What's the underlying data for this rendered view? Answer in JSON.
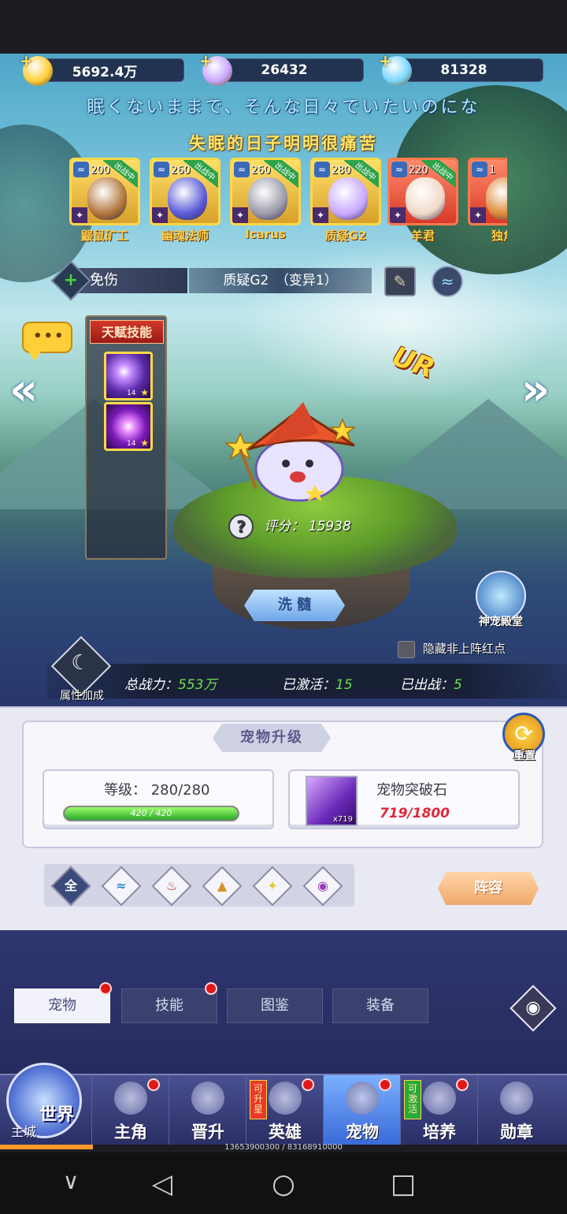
{
  "resources": [
    {
      "name": "gold",
      "value": "5692.4万",
      "color": "#ffcf3a"
    },
    {
      "name": "crystal",
      "value": "26432",
      "color": "#c8a8ff"
    },
    {
      "name": "diamond",
      "value": "81328",
      "color": "#7ad8ff"
    }
  ],
  "marquee": {
    "line1": "眠くないままで、そんな日々でいたいのにな",
    "line2": "失眠的日子明明很痛苦"
  },
  "pets": [
    {
      "level": "200",
      "tag": "出战中",
      "name": "鼹鼠矿工",
      "color": "#b0753a"
    },
    {
      "level": "260",
      "tag": "出战中",
      "name": "幽魂法师",
      "color": "#5a5ad8"
    },
    {
      "level": "260",
      "tag": "出战中",
      "name": "Icarus",
      "color": "#9a9aa8"
    },
    {
      "level": "280",
      "tag": "出战中",
      "name": "质疑G2",
      "color": "#c8a8ff"
    },
    {
      "level": "220",
      "tag": "出战中",
      "name": "羊君",
      "color": "#f0d8c8"
    },
    {
      "level": "1",
      "tag": "",
      "name": "独角",
      "color": "#e08a3a"
    }
  ],
  "skill_bar": {
    "skill_label": "免伤",
    "pet_name": "质疑G2　（变异1）"
  },
  "chat_label": "•••",
  "talent": {
    "title": "天赋技能",
    "skills": [
      {
        "level": "14"
      },
      {
        "level": "14"
      }
    ]
  },
  "ur_label": "UR",
  "score": {
    "label": "评分：",
    "value": "15938"
  },
  "wash_label": "洗 髓",
  "temple_label": "神宠殿堂",
  "hide_red_label": "隐藏非上阵红点",
  "attr_label": "属性加成",
  "stats": [
    {
      "label": "总战力：",
      "value": "553万"
    },
    {
      "label": "已激活：",
      "value": "15"
    },
    {
      "label": "已出战：",
      "value": "5"
    }
  ],
  "upgrade": {
    "title": "宠物升级",
    "level_label": "等级： 280/280",
    "exp_text": "420 / 420",
    "exp_fraction": 1.0,
    "stone_name": "宠物突破石",
    "stone_have": "x719",
    "stone_count": "719/1800",
    "reset_label": "重置"
  },
  "filters": [
    {
      "name": "all",
      "label": "全",
      "color": "#3a4a7a"
    },
    {
      "name": "water",
      "label": "≈",
      "color": "#2a8ac8"
    },
    {
      "name": "fire",
      "label": "♨",
      "color": "#d83a2a"
    },
    {
      "name": "earth",
      "label": "▲",
      "color": "#d8902a"
    },
    {
      "name": "light",
      "label": "✦",
      "color": "#e8c82a"
    },
    {
      "name": "dark",
      "label": "◉",
      "color": "#9a3ab8"
    }
  ],
  "lineup_label": "阵容",
  "tabs": [
    "宠物",
    "技能",
    "图鉴",
    "装备"
  ],
  "nav": [
    {
      "label": "主角"
    },
    {
      "label": "晋升"
    },
    {
      "label": "英雄",
      "badge": "可升星"
    },
    {
      "label": "宠物"
    },
    {
      "label": "培养",
      "badge": "可激活"
    },
    {
      "label": "勋章"
    }
  ],
  "world": {
    "label": "世界",
    "sub": "主城"
  },
  "progress": {
    "text": "13653900300 / 83168910000",
    "fraction": 0.164
  },
  "system_nav": {
    "back": "◁",
    "home": "○",
    "recent": "□",
    "down": "∨"
  }
}
